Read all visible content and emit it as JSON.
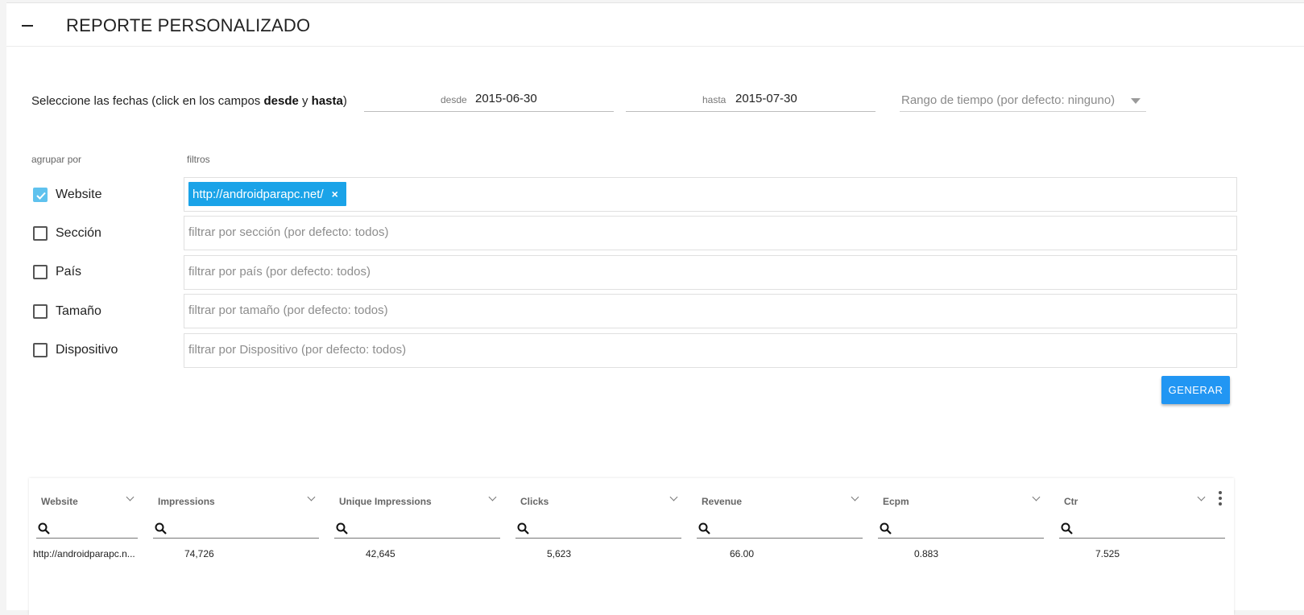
{
  "page": {
    "title": "REPORTE PERSONALIZADO"
  },
  "dates": {
    "label_prefix": "Seleccione las fechas (click en los campos ",
    "label_desde": "desde",
    "label_mid": " y ",
    "label_hasta": "hasta",
    "label_suffix": ")",
    "desde_label": "desde",
    "desde_value": "2015-06-30",
    "hasta_label": "hasta",
    "hasta_value": "2015-07-30",
    "range_placeholder": "Rango de tiempo (por defecto: ninguno)"
  },
  "group_by": {
    "heading": "agrupar por",
    "items": [
      {
        "label": "Website",
        "checked": true
      },
      {
        "label": "Sección",
        "checked": false
      },
      {
        "label": "País",
        "checked": false
      },
      {
        "label": "Tamaño",
        "checked": false
      },
      {
        "label": "Dispositivo",
        "checked": false
      }
    ]
  },
  "filters": {
    "heading": "filtros",
    "website_chip": "http://androidparapc.net/",
    "chip_remove": "×",
    "seccion_placeholder": "filtrar por sección (por defecto: todos)",
    "pais_placeholder": "filtrar por país (por defecto: todos)",
    "tamano_placeholder": "filtrar por tamaño (por defecto: todos)",
    "dispositivo_placeholder": "filtrar por Dispositivo (por defecto: todos)"
  },
  "actions": {
    "generate": "GENERAR"
  },
  "table": {
    "columns": [
      "Website",
      "Impressions",
      "Unique Impressions",
      "Clicks",
      "Revenue",
      "Ecpm",
      "Ctr"
    ],
    "rows": [
      [
        "http://androidparapc.n...",
        "74,726",
        "42,645",
        "5,623",
        "66.00",
        "0.883",
        "7.525"
      ]
    ]
  },
  "colors": {
    "accent": "#2196f3",
    "chip": "#1aa3e8",
    "checkbox": "#5fc2ee"
  }
}
